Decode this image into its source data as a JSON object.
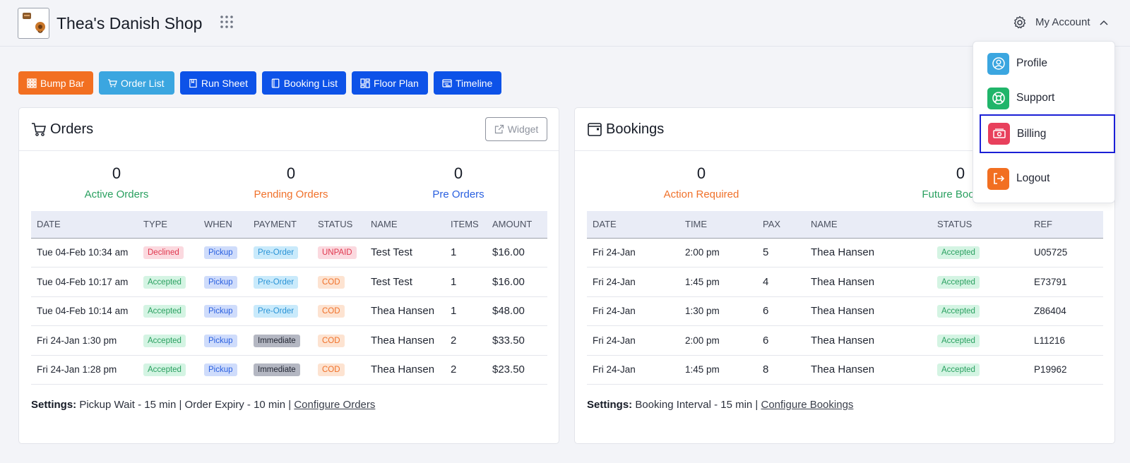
{
  "header": {
    "shop_name": "Thea's Danish Shop",
    "account_label": "My Account"
  },
  "nav_buttons": [
    {
      "label": "Bump Bar",
      "color": "#f26f21"
    },
    {
      "label": "Order List",
      "color": "#3ba6e0"
    },
    {
      "label": "Run Sheet",
      "color": "#0d52e8"
    },
    {
      "label": "Booking List",
      "color": "#0d52e8"
    },
    {
      "label": "Floor Plan",
      "color": "#0d52e8"
    },
    {
      "label": "Timeline",
      "color": "#0d52e8"
    }
  ],
  "orders": {
    "title": "Orders",
    "widget_label": "Widget",
    "stats": [
      {
        "value": "0",
        "label": "Active Orders",
        "color": "#2aa060"
      },
      {
        "value": "0",
        "label": "Pending Orders",
        "color": "#f0712a"
      },
      {
        "value": "0",
        "label": "Pre Orders",
        "color": "#2a60e0"
      }
    ],
    "columns": [
      "DATE",
      "TYPE",
      "WHEN",
      "PAYMENT",
      "STATUS",
      "NAME",
      "ITEMS",
      "AMOUNT"
    ],
    "rows": [
      {
        "date": "Tue 04-Feb 10:34 am",
        "type": "Declined",
        "when": "Pickup",
        "payment": "Pre-Order",
        "status": "UNPAID",
        "name": "Test Test",
        "items": "1",
        "amount": "$16.00"
      },
      {
        "date": "Tue 04-Feb 10:17 am",
        "type": "Accepted",
        "when": "Pickup",
        "payment": "Pre-Order",
        "status": "COD",
        "name": "Test Test",
        "items": "1",
        "amount": "$16.00"
      },
      {
        "date": "Tue 04-Feb 10:14 am",
        "type": "Accepted",
        "when": "Pickup",
        "payment": "Pre-Order",
        "status": "COD",
        "name": "Thea Hansen",
        "items": "1",
        "amount": "$48.00"
      },
      {
        "date": "Fri 24-Jan 1:30 pm",
        "type": "Accepted",
        "when": "Pickup",
        "payment": "Immediate",
        "status": "COD",
        "name": "Thea Hansen",
        "items": "2",
        "amount": "$33.50"
      },
      {
        "date": "Fri 24-Jan 1:28 pm",
        "type": "Accepted",
        "when": "Pickup",
        "payment": "Immediate",
        "status": "COD",
        "name": "Thea Hansen",
        "items": "2",
        "amount": "$23.50"
      }
    ],
    "settings_label": "Settings:",
    "settings_text": " Pickup Wait - 15 min | Order Expiry - 10 min | ",
    "settings_link": "Configure Orders"
  },
  "bookings": {
    "title": "Bookings",
    "stats": [
      {
        "value": "0",
        "label": "Action Required",
        "color": "#f0712a"
      },
      {
        "value": "0",
        "label": "Future Bookings",
        "color": "#2aa060"
      }
    ],
    "columns": [
      "DATE",
      "TIME",
      "PAX",
      "NAME",
      "STATUS",
      "REF"
    ],
    "rows": [
      {
        "date": "Fri 24-Jan",
        "time": "2:00 pm",
        "pax": "5",
        "name": "Thea Hansen",
        "status": "Accepted",
        "ref": "U05725"
      },
      {
        "date": "Fri 24-Jan",
        "time": "1:45 pm",
        "pax": "4",
        "name": "Thea Hansen",
        "status": "Accepted",
        "ref": "E73791"
      },
      {
        "date": "Fri 24-Jan",
        "time": "1:30 pm",
        "pax": "6",
        "name": "Thea Hansen",
        "status": "Accepted",
        "ref": "Z86404"
      },
      {
        "date": "Fri 24-Jan",
        "time": "2:00 pm",
        "pax": "6",
        "name": "Thea Hansen",
        "status": "Accepted",
        "ref": "L11216"
      },
      {
        "date": "Fri 24-Jan",
        "time": "1:45 pm",
        "pax": "8",
        "name": "Thea Hansen",
        "status": "Accepted",
        "ref": "P19962"
      }
    ],
    "settings_label": "Settings:",
    "settings_text": " Booking Interval - 15 min | ",
    "settings_link": "Configure Bookings"
  },
  "account_menu": {
    "items": [
      {
        "label": "Profile",
        "icon": "user-circle-icon",
        "color": "#3ba6e0"
      },
      {
        "label": "Support",
        "icon": "lifebuoy-icon",
        "color": "#20b56a"
      },
      {
        "label": "Billing",
        "icon": "cash-icon",
        "color": "#e8405c"
      },
      {
        "label": "Logout",
        "icon": "logout-icon",
        "color": "#f26f21"
      }
    ]
  }
}
